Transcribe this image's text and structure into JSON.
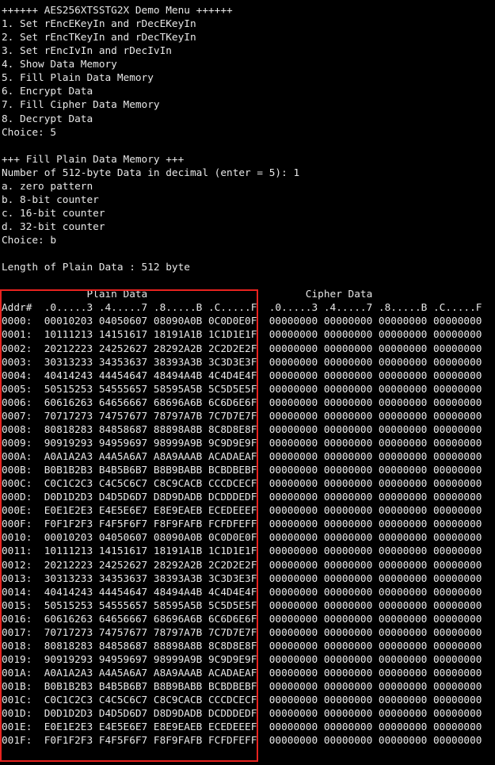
{
  "menu_lines": [
    "++++++ AES256XTSSTG2X Demo Menu ++++++",
    "1. Set rEncEKeyIn and rDecEKeyIn",
    "2. Set rEncTKeyIn and rDecTKeyIn",
    "3. Set rEncIvIn and rDecIvIn",
    "4. Show Data Memory",
    "5. Fill Plain Data Memory",
    "6. Encrypt Data",
    "7. Fill Cipher Data Memory",
    "8. Decrypt Data",
    "Choice: 5",
    "",
    "+++ Fill Plain Data Memory +++",
    "Number of 512-byte Data in decimal (enter = 5): 1",
    "a. zero pattern",
    "b. 8-bit counter",
    "c. 16-bit counter",
    "d. 32-bit counter",
    "Choice: b",
    "",
    "Length of Plain Data : 512 byte",
    "",
    "              Plain Data                          Cipher Data",
    "Addr#  .0.....3 .4.....7 .8.....B .C.....F  .0.....3 .4.....7 .8.....B .C.....F",
    "0000:  00010203 04050607 08090A0B 0C0D0E0F  00000000 00000000 00000000 00000000",
    "0001:  10111213 14151617 18191A1B 1C1D1E1F  00000000 00000000 00000000 00000000",
    "0002:  20212223 24252627 28292A2B 2C2D2E2F  00000000 00000000 00000000 00000000",
    "0003:  30313233 34353637 38393A3B 3C3D3E3F  00000000 00000000 00000000 00000000",
    "0004:  40414243 44454647 48494A4B 4C4D4E4F  00000000 00000000 00000000 00000000",
    "0005:  50515253 54555657 58595A5B 5C5D5E5F  00000000 00000000 00000000 00000000",
    "0006:  60616263 64656667 68696A6B 6C6D6E6F  00000000 00000000 00000000 00000000",
    "0007:  70717273 74757677 78797A7B 7C7D7E7F  00000000 00000000 00000000 00000000",
    "0008:  80818283 84858687 88898A8B 8C8D8E8F  00000000 00000000 00000000 00000000",
    "0009:  90919293 94959697 98999A9B 9C9D9E9F  00000000 00000000 00000000 00000000",
    "000A:  A0A1A2A3 A4A5A6A7 A8A9AAAB ACADAEAF  00000000 00000000 00000000 00000000",
    "000B:  B0B1B2B3 B4B5B6B7 B8B9BABB BCBDBEBF  00000000 00000000 00000000 00000000",
    "000C:  C0C1C2C3 C4C5C6C7 C8C9CACB CCCDCECF  00000000 00000000 00000000 00000000",
    "000D:  D0D1D2D3 D4D5D6D7 D8D9DADB DCDDDEDF  00000000 00000000 00000000 00000000",
    "000E:  E0E1E2E3 E4E5E6E7 E8E9EAEB ECEDEEEF  00000000 00000000 00000000 00000000",
    "000F:  F0F1F2F3 F4F5F6F7 F8F9FAFB FCFDFEFF  00000000 00000000 00000000 00000000",
    "0010:  00010203 04050607 08090A0B 0C0D0E0F  00000000 00000000 00000000 00000000",
    "0011:  10111213 14151617 18191A1B 1C1D1E1F  00000000 00000000 00000000 00000000",
    "0012:  20212223 24252627 28292A2B 2C2D2E2F  00000000 00000000 00000000 00000000",
    "0013:  30313233 34353637 38393A3B 3C3D3E3F  00000000 00000000 00000000 00000000",
    "0014:  40414243 44454647 48494A4B 4C4D4E4F  00000000 00000000 00000000 00000000",
    "0015:  50515253 54555657 58595A5B 5C5D5E5F  00000000 00000000 00000000 00000000",
    "0016:  60616263 64656667 68696A6B 6C6D6E6F  00000000 00000000 00000000 00000000",
    "0017:  70717273 74757677 78797A7B 7C7D7E7F  00000000 00000000 00000000 00000000",
    "0018:  80818283 84858687 88898A8B 8C8D8E8F  00000000 00000000 00000000 00000000",
    "0019:  90919293 94959697 98999A9B 9C9D9E9F  00000000 00000000 00000000 00000000",
    "001A:  A0A1A2A3 A4A5A6A7 A8A9AAAB ACADAEAF  00000000 00000000 00000000 00000000",
    "001B:  B0B1B2B3 B4B5B6B7 B8B9BABB BCBDBEBF  00000000 00000000 00000000 00000000",
    "001C:  C0C1C2C3 C4C5C6C7 C8C9CACB CCCDCECF  00000000 00000000 00000000 00000000",
    "001D:  D0D1D2D3 D4D5D6D7 D8D9DADB DCDDDEDF  00000000 00000000 00000000 00000000",
    "001E:  E0E1E2E3 E4E5E6E7 E8E9EAEB ECEDEEEF  00000000 00000000 00000000 00000000",
    "001F:  F0F1F2F3 F4F5F6F7 F8F9FAFB FCFDFEFF  00000000 00000000 00000000 00000000"
  ],
  "colors": {
    "background": "#000000",
    "text": "#e8e8e8",
    "highlight": "#e8231f"
  }
}
